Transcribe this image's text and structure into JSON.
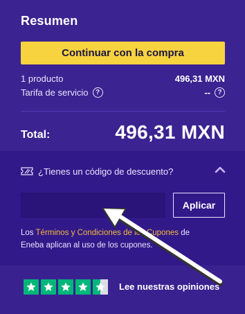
{
  "summary": {
    "title": "Resumen",
    "continue_button": "Continuar con la compra",
    "product_count_label": "1 producto",
    "product_price": "496,31 MXN",
    "service_fee_label": "Tarifa de servicio",
    "service_fee_value": "--",
    "total_label": "Total:",
    "total_value": "496,31 MXN"
  },
  "coupon": {
    "heading": "¿Tienes un código de descuento?",
    "input_value": "",
    "apply_button": "Aplicar",
    "terms_prefix": "Los ",
    "terms_link": "Términos y Condiciones de los Cupones",
    "terms_middle": " de",
    "terms_suffix": "Eneba aplican al uso de los cupones."
  },
  "reviews": {
    "text": "Lee nuestras opiniones",
    "stars": 4.5
  },
  "colors": {
    "background": "#3a2190",
    "accent_button": "#f7d33f",
    "link": "#f5b93a",
    "trustpilot_green": "#00b67a"
  }
}
